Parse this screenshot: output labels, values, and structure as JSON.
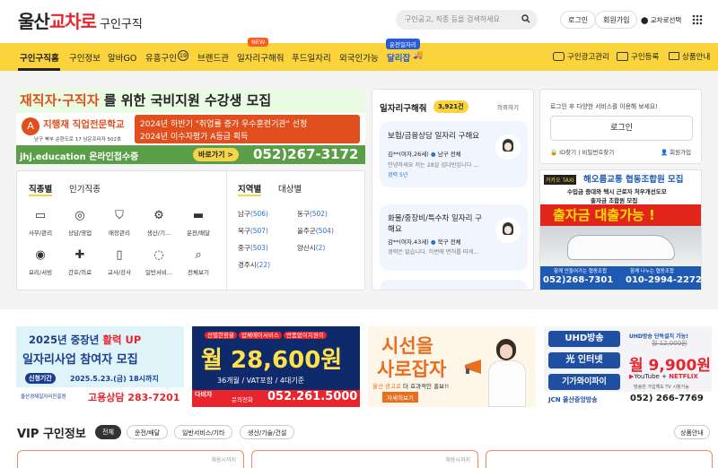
{
  "header": {
    "logo_a": "울산",
    "logo_b": "교차로",
    "logo_c": "구인구직",
    "search_placeholder": "구인공고, 직종 등을 검색하세요",
    "login": "로그인",
    "signup": "회원가입",
    "location": "교차로선택"
  },
  "nav": {
    "items": [
      "구인구직홈",
      "구인정보",
      "알바GO",
      "유흥구인",
      "브랜드관",
      "일자리구해줘",
      "푸드일자리",
      "외국인가능",
      "달리잡"
    ],
    "badge_count": "19",
    "new_tag": "NEW",
    "dalijob_tag": "운전일자리",
    "right": [
      "구인광고관리",
      "구인등록",
      "상품안내"
    ]
  },
  "banner1": {
    "line1a": "재직자·구직자",
    "line1b": " 를 위한 국비지원 수강생 모집",
    "school": "지행재 직업전문학교",
    "addr": "남구 북부 순환도로 17 남운프라자 502호",
    "l1": "2024년 하반기 \"취업률 증가 우수훈련기관\" 선정",
    "l2": "2024년 이수자평가 A등급 획득",
    "url": "jhj.education 온라인접수중",
    "go": "바로가기 >",
    "phone": "052)267-3172"
  },
  "category": {
    "tabs": [
      "직종별",
      "인기직종"
    ],
    "jobs": [
      "사무/관리",
      "상담/영업",
      "매장관리",
      "생산/기...",
      "운전/배달",
      "요리/서빙",
      "간호/의료",
      "교사/강사",
      "일반서비...",
      "전체보기"
    ],
    "region_tabs": [
      "지역별",
      "대상별"
    ],
    "regions": [
      {
        "name": "남구",
        "count": "(506)"
      },
      {
        "name": "동구",
        "count": "(502)"
      },
      {
        "name": "북구",
        "count": "(507)"
      },
      {
        "name": "울주군",
        "count": "(504)"
      },
      {
        "name": "중구",
        "count": "(503)"
      },
      {
        "name": "양산시",
        "count": "(2)"
      },
      {
        "name": "경주시",
        "count": "(22)"
      }
    ]
  },
  "wanted": {
    "title": "일자리구해줘",
    "count": "3,921건",
    "request": "의뢰하기",
    "items": [
      {
        "title": "보험/금융상담 일자리 구해요",
        "who": "김**(여자,26세)",
        "loc": "남구 전체",
        "desc": "안녕하세요 저는 28살 김다빈입니다 ...",
        "career": "경력 5년"
      },
      {
        "title": "화물/중장비/특수차 일자리 구해요",
        "who": "감**(여자,43세)",
        "loc": "북구 전체",
        "desc": "경력은 없습니다. 이번에 면허를 따게...",
        "career": ""
      }
    ]
  },
  "login_box": {
    "msg": "로그인 후 다양한 서비스를 이용해 보세요!",
    "button": "로그인",
    "id_find": "ID찾기",
    "pw_find": "비밀번호찾기",
    "join": "회원가입"
  },
  "taxi_ad": {
    "brand": "카카오 TAXI",
    "title": "해오름교통 협동조합원 모집",
    "l1": "수입금 증대와 택시 근로자 처우개선도모",
    "l2": "출자금 조합원 모집",
    "big": "출자금 대출가능 !",
    "c1": "함께 만들어가는 협동조합",
    "c2": "함께 나누는 협동조합",
    "p1": "052)268-7301",
    "p2": "010-2994-2272"
  },
  "ads": [
    {
      "year": "2025년 중장년",
      "hl": "활력 UP",
      "l2": "일자리사업 참여자 모집",
      "period": "신청기간",
      "date": "2025.5.23.(금) 18시까지",
      "org": "울산경제일자리진흥원",
      "tel": "고용상담 283-7201"
    },
    {
      "t1": "선별한환율",
      "t2": "업체에이서비스",
      "t3": "반품없이지원이",
      "price": "월 28,600원",
      "sub": "36개월 / VAT포함 / 4대기준",
      "tel": "052.261.5000",
      "tag": "문의전화",
      "brand": "다비자"
    },
    {
      "l1": "시선을",
      "l2": "사로잡자",
      "sub": "울산 광고로",
      "sub2": "더 효과적인 홍보!!",
      "btn": "자세히보기"
    },
    {
      "b1": "UHD방송",
      "b2": "光 인터넷",
      "b3": "기가와이파이",
      "r1": "UHD방송 단독설치 가능!",
      "r2": "월 12,000원",
      "price": "월 9,900원",
      "yt": "YouTube",
      "nf": "NETFLIX",
      "r3": "방송만 가입해도 TV 시청가능",
      "brand": "JCN 울산중앙방송",
      "tel": "052) 266-7769"
    }
  ],
  "vip": {
    "title": "VIP 구인정보",
    "tabs": [
      "전체",
      "운전/배달",
      "일반서비스/기타",
      "생산/기술/건설"
    ],
    "info": "상품안내",
    "note": "채용시까지"
  }
}
